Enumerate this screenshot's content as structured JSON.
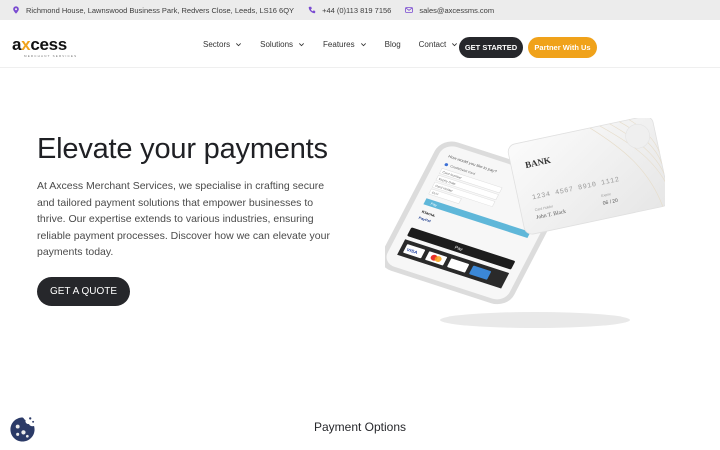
{
  "topbar": {
    "address": "Richmond House, Lawnswood Business Park, Redvers Close, Leeds, LS16 6QY",
    "phone": "+44 (0)113 819 7156",
    "email": "sales@axcessms.com",
    "icon_color": "#7a4bd1"
  },
  "brand": {
    "name_pre": "a",
    "name_x": "x",
    "name_post": "cess",
    "tagline": "MERCHANT SERVICES",
    "accent": "#f0a21a"
  },
  "nav": {
    "items": [
      {
        "label": "Sectors",
        "dropdown": true
      },
      {
        "label": "Solutions",
        "dropdown": true
      },
      {
        "label": "Features",
        "dropdown": true
      },
      {
        "label": "Blog",
        "dropdown": false
      },
      {
        "label": "Contact",
        "dropdown": true
      }
    ],
    "get_started": "GET STARTED",
    "partner": "Partner With Us"
  },
  "hero": {
    "title": "Elevate your payments",
    "text": "At Axcess Merchant Services, we specialise in crafting secure and tailored payment solutions that empower businesses to thrive. Our expertise extends to various industries, ensuring reliable payment processes. Discover how we can elevate your payments today.",
    "cta": "GET A QUOTE"
  },
  "card": {
    "bank": "BANK",
    "number": "1234 4567 8910 1112",
    "holder_label": "Card Holder",
    "holder": "John T. Black",
    "expiry_label": "Expire",
    "expiry": "06 / 20"
  },
  "phone_screen": {
    "question": "How would you like to pay?",
    "options": [
      "Credit/Debit Card",
      "Card Number",
      "Expiry Date",
      "Card Holder",
      "CVV"
    ],
    "pay_label": "Pay",
    "klarna": "Klarna.",
    "paypal": "PayPal",
    "apple_pay": "Pay"
  },
  "footer_section": {
    "title": "Payment Options"
  }
}
